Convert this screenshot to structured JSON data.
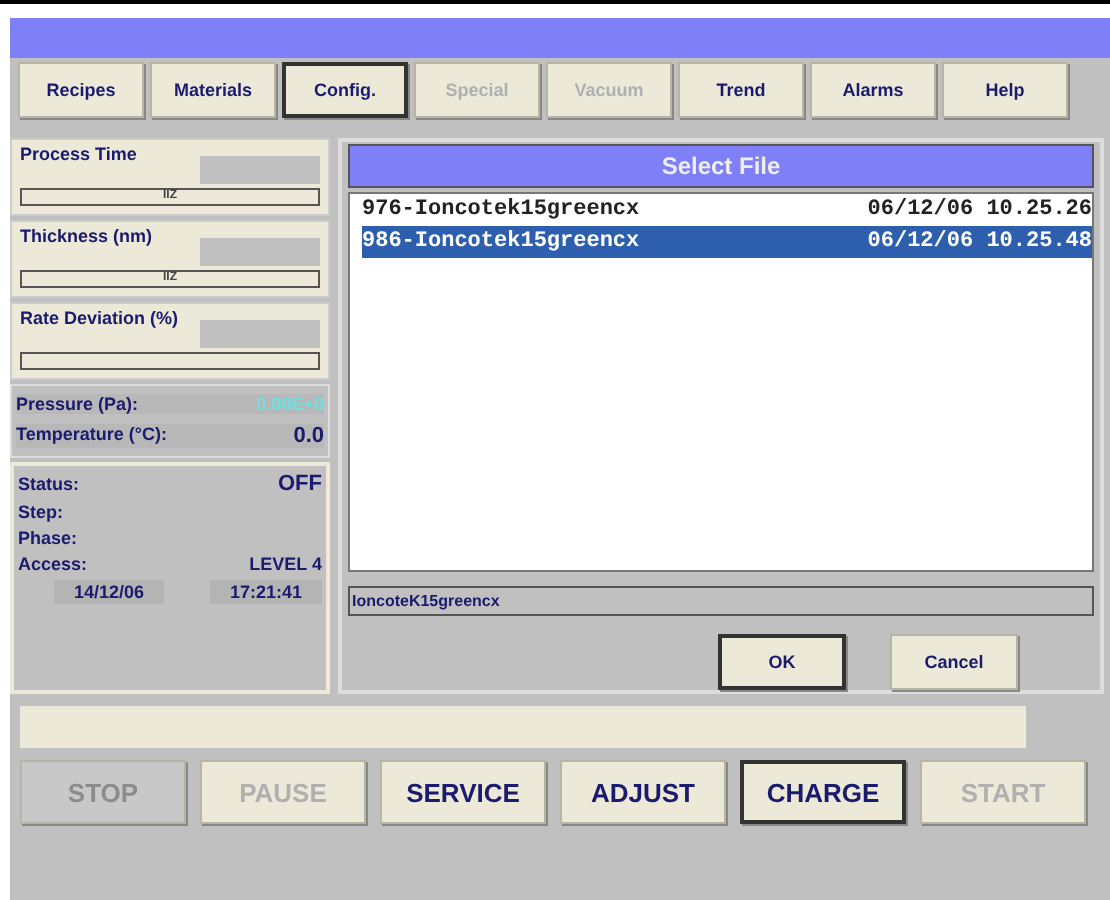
{
  "nav_tabs": [
    {
      "label": "Recipes",
      "selected": false,
      "disabled": false
    },
    {
      "label": "Materials",
      "selected": false,
      "disabled": false
    },
    {
      "label": "Config.",
      "selected": true,
      "disabled": false
    },
    {
      "label": "Special",
      "selected": false,
      "disabled": true
    },
    {
      "label": "Vacuum",
      "selected": false,
      "disabled": true
    },
    {
      "label": "Trend",
      "selected": false,
      "disabled": false
    },
    {
      "label": "Alarms",
      "selected": false,
      "disabled": false
    },
    {
      "label": "Help",
      "selected": false,
      "disabled": false
    }
  ],
  "gauges": [
    {
      "title": "Process Time",
      "bar_text": "IIZ",
      "level": 0
    },
    {
      "title": "Thickness (nm)",
      "bar_text": "IIZ",
      "level": 0
    },
    {
      "title": "Rate Deviation (%)",
      "level": 0
    }
  ],
  "readings": [
    {
      "label": "Pressure (Pa):",
      "value": "0.00E+0"
    },
    {
      "label": "Temperature (°C):",
      "value": "0.0"
    }
  ],
  "status": {
    "status_label": "Status:",
    "status_value": "OFF",
    "step_label": "Step:",
    "phase_label": "Phase:",
    "access_label": "Access:",
    "access_value": "LEVEL 4",
    "date": "14/12/06",
    "time": "17:21:41"
  },
  "dialog": {
    "title": "Select File",
    "files": [
      {
        "name": "976-Ioncotek15greencx",
        "date": "06/12/06 10.25.26",
        "selected": false
      },
      {
        "name": "986-Ioncotek15greencx",
        "date": "06/12/06 10.25.48",
        "selected": true
      }
    ],
    "filename": "IoncoteK15greencx",
    "ok": "OK",
    "cancel": "Cancel"
  },
  "actions": [
    {
      "label": "STOP",
      "selected": false,
      "disabled": true
    },
    {
      "label": "PAUSE",
      "selected": false,
      "disabled": true
    },
    {
      "label": "SERVICE",
      "selected": false,
      "disabled": false
    },
    {
      "label": "ADJUST",
      "selected": false,
      "disabled": false
    },
    {
      "label": "CHARGE",
      "selected": true,
      "disabled": false
    },
    {
      "label": "START",
      "selected": false,
      "disabled": true
    }
  ]
}
